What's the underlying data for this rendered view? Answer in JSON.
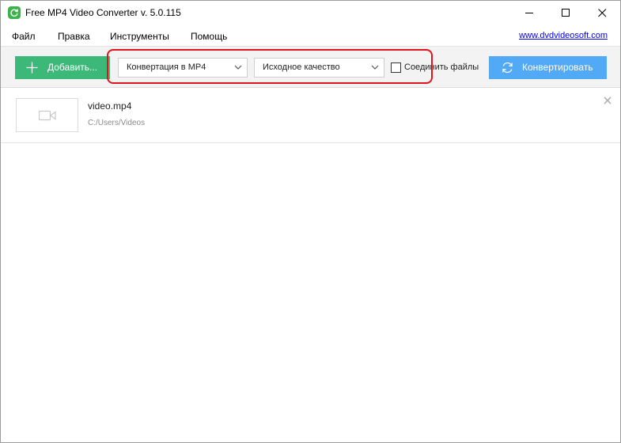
{
  "window": {
    "title": "Free MP4 Video Converter v. 5.0.115"
  },
  "menu": {
    "items": [
      "Файл",
      "Правка",
      "Инструменты",
      "Помощь"
    ],
    "website": "www.dvdvideosoft.com"
  },
  "toolbar": {
    "add_label": "Добавить...",
    "format_value": "Конвертация в MP4",
    "quality_value": "Исходное качество",
    "merge_label": "Соединить файлы",
    "merge_checked": false,
    "convert_label": "Конвертировать"
  },
  "files": [
    {
      "name": "video.mp4",
      "path": "C:/Users/Videos"
    }
  ],
  "colors": {
    "add_button": "#3cb878",
    "convert_button": "#52a9f5",
    "highlight": "#e0141c",
    "app_icon": "#3cb34a"
  },
  "icons": {
    "app": "refresh-icon",
    "add": "plus-icon",
    "convert": "refresh-icon",
    "thumbnail": "video-camera-icon",
    "remove": "close-icon"
  }
}
